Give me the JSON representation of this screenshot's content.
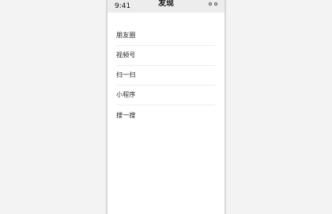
{
  "status_bar": {
    "time": "9:41",
    "icons": [
      "circle-icon",
      "circle-icon"
    ]
  },
  "header": {
    "title": "发现"
  },
  "discover_list": {
    "items": [
      {
        "label": "朋友圈"
      },
      {
        "label": "视频号"
      },
      {
        "label": "扫一扫"
      },
      {
        "label": "小程序"
      },
      {
        "label": "搜一搜"
      }
    ]
  },
  "colors": {
    "header_bg": "#ededed",
    "page_bg": "#ffffff",
    "outer_bg": "#f3f3f3",
    "divider": "#eeeeee"
  }
}
